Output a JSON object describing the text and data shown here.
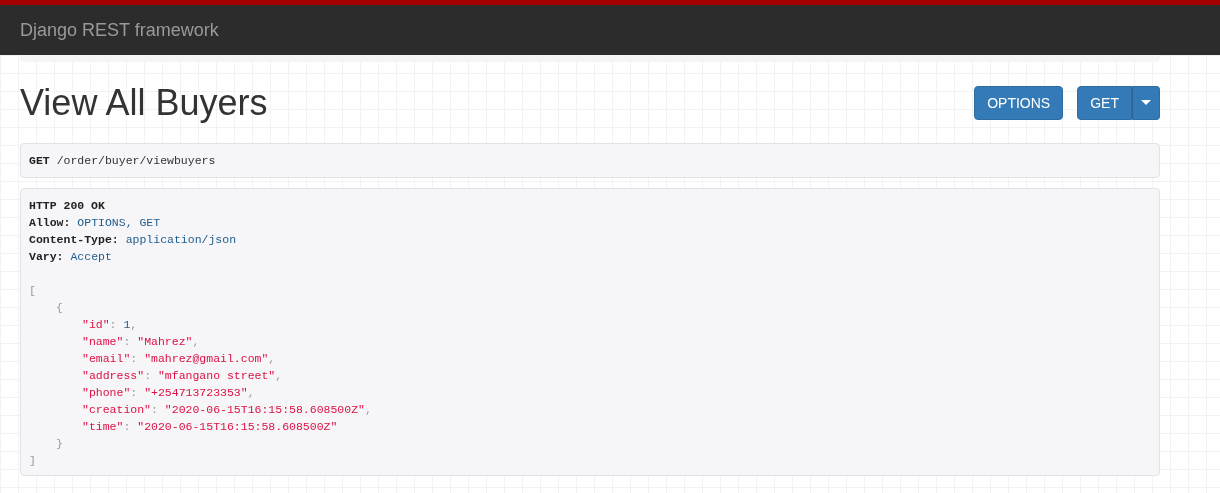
{
  "navbar": {
    "brand": "Django REST framework"
  },
  "page": {
    "title": "View All Buyers"
  },
  "buttons": [
    {
      "label": "OPTIONS",
      "kind": "plain"
    },
    {
      "label": "GET",
      "kind": "split"
    }
  ],
  "request": {
    "method": "GET",
    "path": "/order/buyer/viewbuyers"
  },
  "response": {
    "status": "HTTP 200 OK",
    "headers": [
      {
        "name": "Allow:",
        "value": "OPTIONS, GET"
      },
      {
        "name": "Content-Type:",
        "value": "application/json"
      },
      {
        "name": "Vary:",
        "value": "Accept"
      }
    ],
    "body": {
      "open": "[",
      "close": "]",
      "items": [
        {
          "open": "{",
          "close": "}",
          "fields": [
            {
              "key": "\"id\"",
              "colon": ":",
              "value": "1",
              "kind": "number",
              "comma": ","
            },
            {
              "key": "\"name\"",
              "colon": ":",
              "value": "\"Mahrez\"",
              "kind": "string",
              "comma": ","
            },
            {
              "key": "\"email\"",
              "colon": ":",
              "value": "\"mahrez@gmail.com\"",
              "kind": "string",
              "comma": ","
            },
            {
              "key": "\"address\"",
              "colon": ":",
              "value": "\"mfangano street\"",
              "kind": "string",
              "comma": ","
            },
            {
              "key": "\"phone\"",
              "colon": ":",
              "value": "\"+254713723353\"",
              "kind": "string",
              "comma": ","
            },
            {
              "key": "\"creation\"",
              "colon": ":",
              "value": "\"2020-06-15T16:15:58.608500Z\"",
              "kind": "string",
              "comma": ","
            },
            {
              "key": "\"time\"",
              "colon": ":",
              "value": "\"2020-06-15T16:15:58.608500Z\"",
              "kind": "string"
            }
          ]
        }
      ]
    }
  }
}
